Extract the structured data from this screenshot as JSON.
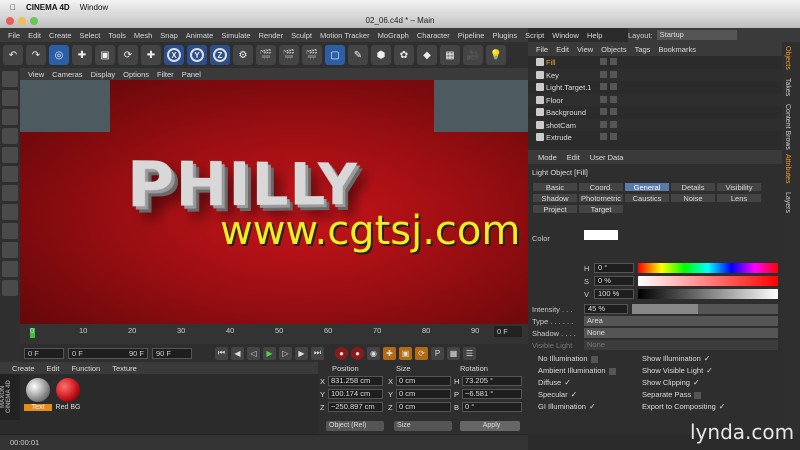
{
  "mac_menu": {
    "app": "CINEMA 4D",
    "window": "Window"
  },
  "window_title": "02_06.c4d * – Main",
  "menu": [
    "File",
    "Edit",
    "Create",
    "Select",
    "Tools",
    "Mesh",
    "Snap",
    "Animate",
    "Simulate",
    "Render",
    "Sculpt",
    "Motion Tracker",
    "MoGraph",
    "Character",
    "Pipeline",
    "Plugins",
    "Script",
    "Window",
    "Help"
  ],
  "layout": {
    "label": "Layout:",
    "value": "Startup"
  },
  "toolbar_axes": [
    "X",
    "Y",
    "Z"
  ],
  "view_menu": [
    "View",
    "Cameras",
    "Display",
    "Options",
    "Filter",
    "Panel"
  ],
  "viewport": {
    "title_text": "PHILLY",
    "watermark": "www.cgtsj.com"
  },
  "timeline": {
    "ticks": [
      "0",
      "10",
      "20",
      "30",
      "40",
      "50",
      "60",
      "70",
      "80",
      "90"
    ],
    "current": "0 F"
  },
  "transport": {
    "start": "0 F",
    "min": "0 F",
    "max": "90 F",
    "end": "90 F"
  },
  "material_menu": [
    "Create",
    "Edit",
    "Function",
    "Texture"
  ],
  "materials": [
    {
      "name": "Text",
      "color": "#b8b8b8"
    },
    {
      "name": "Red BG",
      "color": "#c8141a"
    }
  ],
  "cinema_logo": "MAXON CINEMA 4D",
  "coords": {
    "headers": [
      "Position",
      "Size",
      "Rotation"
    ],
    "rows": [
      {
        "axis": "X",
        "pos": "831.258 cm",
        "size_axis": "X",
        "size": "0 cm",
        "rot_axis": "H",
        "rot": "73.205 °"
      },
      {
        "axis": "Y",
        "pos": "100.174 cm",
        "size_axis": "Y",
        "size": "0 cm",
        "rot_axis": "P",
        "rot": "−6.581 °"
      },
      {
        "axis": "Z",
        "pos": "−250.897 cm",
        "size_axis": "Z",
        "size": "0 cm",
        "rot_axis": "B",
        "rot": "0 °"
      }
    ],
    "mode": "Object (Rel)",
    "size_mode": "Size",
    "apply": "Apply"
  },
  "status": "00:00:01",
  "object_menu": [
    "File",
    "Edit",
    "View",
    "Objects",
    "Tags",
    "Bookmarks"
  ],
  "objects": [
    {
      "name": "Fill",
      "highlight": true
    },
    {
      "name": "Key",
      "highlight": false
    },
    {
      "name": "Light.Target.1",
      "highlight": false
    },
    {
      "name": "Floor",
      "highlight": false
    },
    {
      "name": "Background",
      "highlight": false
    },
    {
      "name": "shotCam",
      "highlight": false
    },
    {
      "name": "Extrude",
      "highlight": false
    }
  ],
  "side_tabs_top": [
    "Objects",
    "Takes",
    "Content Browser"
  ],
  "side_tabs_bottom": [
    "Attributes",
    "Layers"
  ],
  "attr_menu": [
    "Mode",
    "Edit",
    "User Data"
  ],
  "attr": {
    "title": "Light Object [Fill]",
    "tabs_row1": [
      "Basic",
      "Coord.",
      "General",
      "Details",
      "Visibility"
    ],
    "tabs_row2": [
      "Shadow",
      "Photometric",
      "Caustics",
      "Noise",
      "Lens"
    ],
    "tabs_row3": [
      "Project",
      "Target"
    ],
    "active_tab": "General",
    "color_label": "Color",
    "h_label": "H",
    "h_value": "0 °",
    "s_label": "S",
    "s_value": "0 %",
    "v_label": "V",
    "v_value": "100 %",
    "intensity_label": "Intensity . . .",
    "intensity": "45 %",
    "type_label": "Type . . . . . .",
    "type": "Area",
    "shadow_label": "Shadow . . . .",
    "shadow": "None",
    "visible_label": "Visible Light",
    "visible": "None",
    "checks_left": [
      {
        "label": "No Illumination",
        "checked": false
      },
      {
        "label": "Ambient Illumination",
        "checked": false
      },
      {
        "label": "Diffuse",
        "checked": true
      },
      {
        "label": "Specular",
        "checked": true
      },
      {
        "label": "GI Illumination",
        "checked": true
      }
    ],
    "checks_right": [
      {
        "label": "Show Illumination",
        "checked": true
      },
      {
        "label": "Show Visible Light",
        "checked": true
      },
      {
        "label": "Show Clipping",
        "checked": true
      },
      {
        "label": "Separate Pass",
        "checked": false
      },
      {
        "label": "Export to Compositing",
        "checked": true
      }
    ]
  },
  "lynda": "lynda.com"
}
